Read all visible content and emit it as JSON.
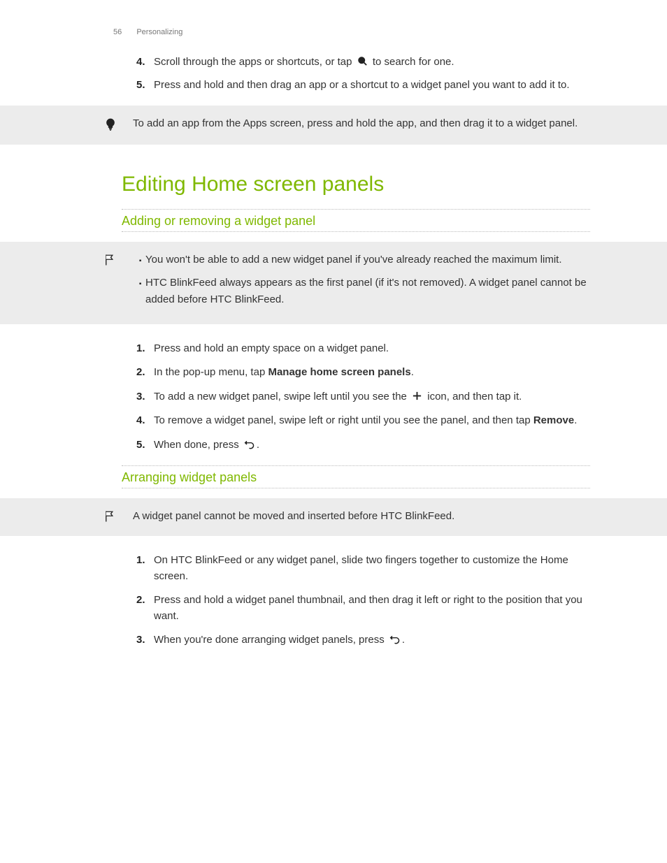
{
  "header": {
    "page_number": "56",
    "section": "Personalizing"
  },
  "top_steps": [
    {
      "num": "4.",
      "before": "Scroll through the apps or shortcuts, or tap ",
      "after": " to search for one.",
      "icon": "search"
    },
    {
      "num": "5.",
      "before": "Press and hold and then drag an app or a shortcut to a widget panel you want to add it to.",
      "after": "",
      "icon": ""
    }
  ],
  "tip_box": {
    "text": "To add an app from the Apps screen, press and hold the app, and then drag it to a widget panel."
  },
  "section_title": "Editing Home screen panels",
  "sub1": {
    "title": "Adding or removing a widget panel",
    "notes": [
      "You won't be able to add a new widget panel if you've already reached the maximum limit.",
      "HTC BlinkFeed always appears as the first panel (if it's not removed). A widget panel cannot be added before HTC BlinkFeed."
    ],
    "steps": [
      {
        "num": "1.",
        "parts": [
          "Press and hold an empty space on a widget panel."
        ]
      },
      {
        "num": "2.",
        "parts": [
          "In the pop-up menu, tap ",
          {
            "strong": "Manage home screen panels"
          },
          "."
        ]
      },
      {
        "num": "3.",
        "parts": [
          "To add a new widget panel, swipe left until you see the ",
          {
            "icon": "plus"
          },
          " icon, and then tap it."
        ]
      },
      {
        "num": "4.",
        "parts": [
          "To remove a widget panel, swipe left or right until you see the panel, and then tap ",
          {
            "strong": "Remove"
          },
          "."
        ]
      },
      {
        "num": "5.",
        "parts": [
          "When done, press ",
          {
            "icon": "back"
          },
          "."
        ]
      }
    ]
  },
  "sub2": {
    "title": "Arranging widget panels",
    "note": "A widget panel cannot be moved and inserted before HTC BlinkFeed.",
    "steps": [
      {
        "num": "1.",
        "parts": [
          "On HTC BlinkFeed or any widget panel, slide two fingers together to customize the Home screen."
        ]
      },
      {
        "num": "2.",
        "parts": [
          "Press and hold a widget panel thumbnail, and then drag it left or right to the position that you want."
        ]
      },
      {
        "num": "3.",
        "parts": [
          "When you're done arranging widget panels, press ",
          {
            "icon": "back"
          },
          "."
        ]
      }
    ]
  }
}
